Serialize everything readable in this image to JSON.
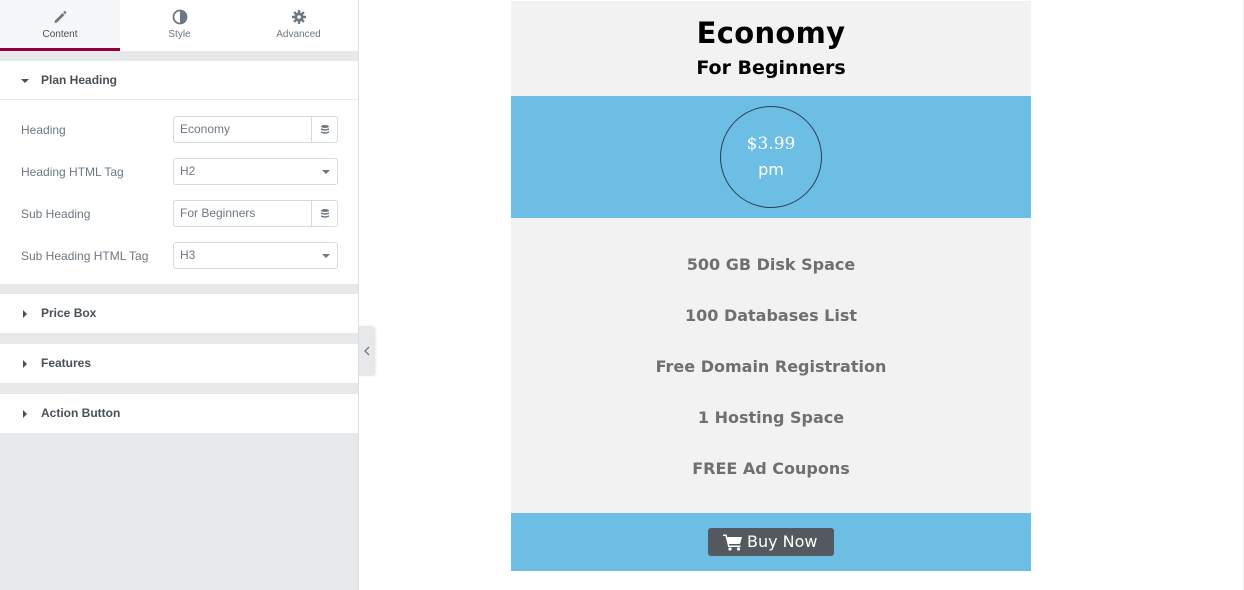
{
  "tabs": [
    {
      "label": "Content",
      "icon": "pencil-icon"
    },
    {
      "label": "Style",
      "icon": "half-circle-icon"
    },
    {
      "label": "Advanced",
      "icon": "gear-icon"
    }
  ],
  "sections": {
    "plan_heading": {
      "title": "Plan Heading"
    },
    "price_box": {
      "title": "Price Box"
    },
    "features": {
      "title": "Features"
    },
    "action_button": {
      "title": "Action Button"
    }
  },
  "fields": {
    "heading": {
      "label": "Heading",
      "value": "Economy"
    },
    "heading_tag": {
      "label": "Heading HTML Tag",
      "value": "H2"
    },
    "sub_heading": {
      "label": "Sub Heading",
      "value": "For Beginners"
    },
    "sub_heading_tag": {
      "label": "Sub Heading HTML Tag",
      "value": "H3"
    }
  },
  "card": {
    "heading": "Economy",
    "sub_heading": "For Beginners",
    "price": "$3.99",
    "period": "pm",
    "features": [
      "500 GB Disk Space",
      "100 Databases List",
      "Free Domain Registration",
      "1 Hosting Space",
      "FREE Ad Coupons"
    ],
    "button_label": "Buy Now"
  },
  "colors": {
    "accent": "#93003c",
    "band": "#6dbee5",
    "button": "#54595f",
    "card_bg": "#f2f2f2"
  }
}
